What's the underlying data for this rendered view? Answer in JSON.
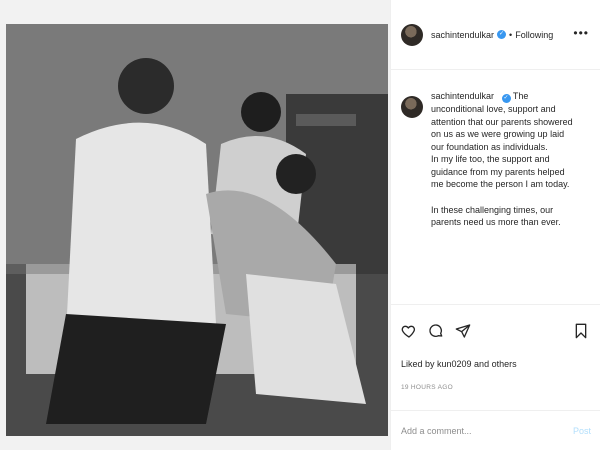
{
  "post": {
    "username": "sachintendulkar",
    "verified": true,
    "dot": "•",
    "follow_status": "Following",
    "more_icon": "more-options-icon"
  },
  "caption": {
    "username": "sachintendulkar",
    "lines": [
      "The",
      "unconditional love, support and",
      "attention that our parents showered",
      "on us as we were growing up laid",
      "our foundation as individuals.",
      "In my life too, the support and",
      "guidance from my parents helped",
      "me become the person I am today.",
      "In these challenging times, our",
      "parents need us more than ever."
    ]
  },
  "actions": {
    "icons": [
      "heart-icon",
      "comment-icon",
      "share-icon",
      "bookmark-icon"
    ],
    "likes_text": "Liked by kun0209 and others",
    "timestamp": "19 HOURS AGO"
  },
  "comment": {
    "placeholder": "Add a comment...",
    "post_label": "Post"
  },
  "colors": {
    "verified_blue": "#3897f0",
    "post_button": "#b2dffc",
    "muted": "#8e8e8e"
  }
}
